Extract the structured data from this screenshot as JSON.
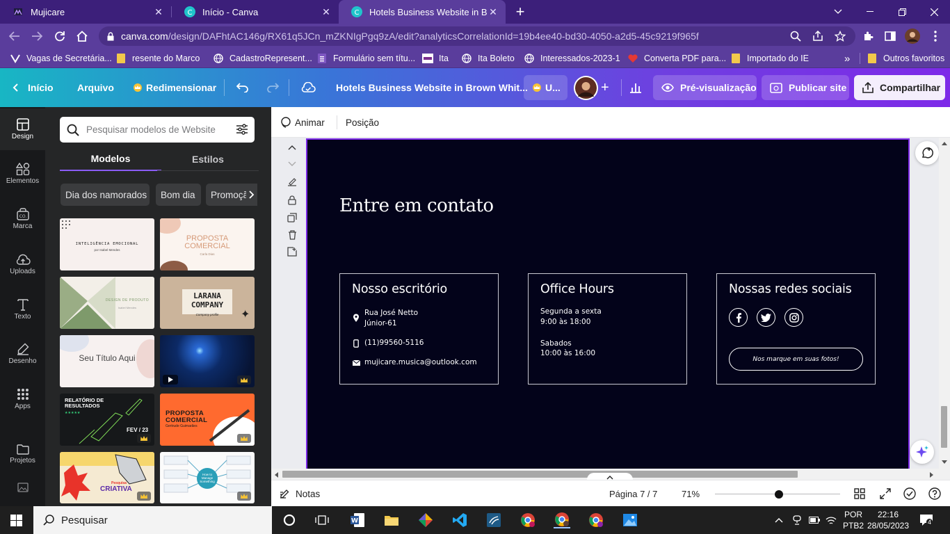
{
  "browser": {
    "tabs": [
      {
        "title": "Mujicare",
        "active": false
      },
      {
        "title": "Início - Canva",
        "active": false
      },
      {
        "title": "Hotels Business Website in Brown",
        "active": true
      }
    ],
    "url_host": "canva.com",
    "url_path": "/design/DAFhtAC146g/RX61q5JCn_mZKNIgPgq9zA/edit?analyticsCorrelationId=19b4ee40-bd30-4050-a2d5-45c9219f965f",
    "bookmarks": [
      "Vagas de Secretária...",
      "resente do Marco",
      "CadastroRepresent...",
      "Formulário sem títu...",
      "Ita",
      "Ita Boleto",
      "Interessados-2023-1",
      "Converta PDF para...",
      "Importado do IE",
      "Outros favoritos"
    ],
    "bookmarks_more": "»"
  },
  "canva_top": {
    "home": "Início",
    "file": "Arquivo",
    "resize": "Redimensionar",
    "doc_title": "Hotels Business Website in Brown Whit...",
    "upgrade": "U...",
    "preview": "Pré-visualização",
    "publish": "Publicar site",
    "share": "Compartilhar"
  },
  "rail": [
    {
      "label": "Design",
      "icon": "layout-icon"
    },
    {
      "label": "Elementos",
      "icon": "shapes-icon"
    },
    {
      "label": "Marca",
      "icon": "brand-icon"
    },
    {
      "label": "Uploads",
      "icon": "cloud-upload-icon"
    },
    {
      "label": "Texto",
      "icon": "text-icon"
    },
    {
      "label": "Desenho",
      "icon": "draw-icon"
    },
    {
      "label": "Apps",
      "icon": "apps-icon"
    },
    {
      "label": "Projetos",
      "icon": "folder-icon"
    }
  ],
  "panel": {
    "search_placeholder": "Pesquisar modelos de Website",
    "tabs": [
      "Modelos",
      "Estilos"
    ],
    "chips": [
      "Dia dos namorados",
      "Bom dia",
      "Promoção"
    ],
    "thumbs": {
      "t1_title": "INTELIGÊNCIA EMOCIONAL",
      "t1_sub": "por Isabel Mendes",
      "t2_title": "PROPOSTA COMERCIAL",
      "t2_sub": "Carla Dias",
      "t3_title": "DESIGN DE PRODUTO",
      "t3_sub": "Isabel Mendes",
      "t4_title": "LARANA COMPANY",
      "t4_sub": "Company profile",
      "t5_title": "Seu Título Aqui",
      "t7_title": "RELATÓRIO DE RESULTADOS",
      "t7_date": "FEV / 23",
      "t8_title": "PROPOSTA COMERCIAL",
      "t8_sub": "Gertrude Guimarães",
      "t9_title": "CRIATIVA",
      "t9_pre": "Pesquisa",
      "t10_title": "How to Manage Something"
    }
  },
  "editor": {
    "animate": "Animar",
    "position": "Posição",
    "heading": "Entre em contato",
    "office": {
      "title": "Nosso escritório",
      "address1": "Rua José Netto",
      "address2": "Júnior-61",
      "phone": "(11)99560-5116",
      "email": "mujicare.musica@outlook.com"
    },
    "hours": {
      "title": "Office Hours",
      "week_label": "Segunda a sexta",
      "week_time": "9:00 às 18:00",
      "sat_label": "Sabados",
      "sat_time": "10:00 às 16:00"
    },
    "social": {
      "title": "Nossas redes sociais",
      "tag_button": "Nos marque em suas fotos!",
      "icons": [
        "facebook-icon",
        "twitter-icon",
        "instagram-icon"
      ]
    }
  },
  "bottom": {
    "notes": "Notas",
    "page": "Página 7 / 7",
    "zoom": "71%",
    "zoom_level": 0.51
  },
  "taskbar": {
    "search": "Pesquisar",
    "lang1": "POR",
    "lang2": "PTB2",
    "time": "22:16",
    "date": "28/05/2023",
    "notifications": "4"
  },
  "colors": {
    "canva_purple": "#7d2ae8",
    "page_bg": "#03031a",
    "browser_frame": "#3c1f7a"
  }
}
